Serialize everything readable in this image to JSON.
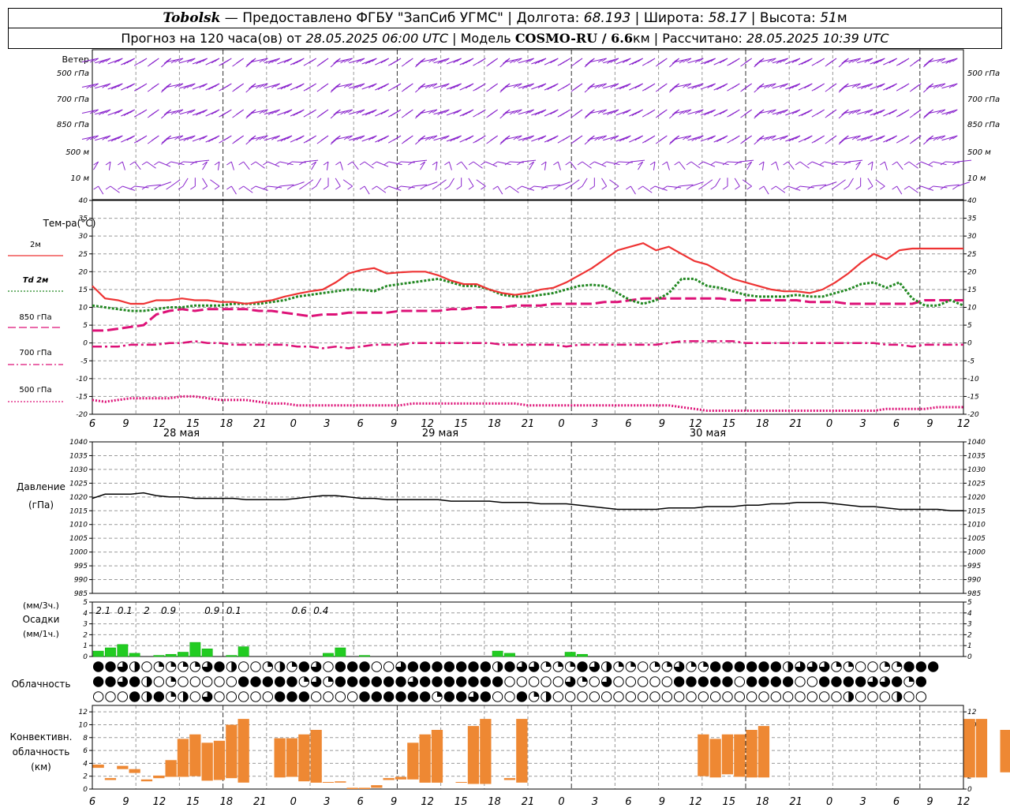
{
  "header": {
    "station": "Tobolsk",
    "provided": "— Предоставлено ФГБУ \"ЗапСиб УГМС\"",
    "lon_label": "Долгота:",
    "lon": "68.193",
    "lat_label": "Широта:",
    "lat": "58.17",
    "alt_label": "Высота:",
    "alt": "51",
    "alt_unit": "м",
    "forecast_label": "Прогноз на 120 часа(ов) от",
    "forecast_time": "28.05.2025 06:00 UTC",
    "model_label": "Модель",
    "model": "COSMO-RU / 6.6",
    "model_unit": "км",
    "calc_label": "Рассчитано:",
    "calc_time": "28.05.2025 10:39 UTC"
  },
  "labels": {
    "wind": "Ветер",
    "wind_levels": [
      "500 гПа",
      "700 гПа",
      "850 гПа",
      "500 м",
      "10 м"
    ],
    "temp_title": "Тем-ра(°С)",
    "legend": [
      {
        "label": "2м",
        "color": "#ee3333",
        "dash": "solid"
      },
      {
        "label": "Td 2м",
        "color": "#228822",
        "dash": "dotted"
      },
      {
        "label": "850 гПа",
        "color": "#dd1177",
        "dash": "longdash"
      },
      {
        "label": "700 гПа",
        "color": "#dd1177",
        "dash": "dashdot"
      },
      {
        "label": "500 гПа",
        "color": "#dd1177",
        "dash": "dot"
      }
    ],
    "pressure": "Давление",
    "pressure_unit": "(гПа)",
    "precip_unit1": "(мм/3ч.)",
    "precip": "Осадки",
    "precip_unit2": "(мм/1ч.)",
    "cloud": "Облачность",
    "conv1": "Конвективн.",
    "conv2": "облачность",
    "conv3": "(км)"
  },
  "chart_data": {
    "x_tick_labels": [
      "6",
      "9",
      "12",
      "15",
      "18",
      "21",
      "0",
      "3",
      "6",
      "9",
      "12",
      "15",
      "18",
      "21",
      "0",
      "3",
      "6",
      "9",
      "12",
      "15",
      "18",
      "21",
      "0",
      "3",
      "6",
      "9",
      "12"
    ],
    "date_labels": [
      "28 мая",
      "29 мая",
      "30 мая"
    ],
    "colors": {
      "wind": "#8822cc",
      "t2m": "#ee3333",
      "td": "#228822",
      "t850": "#dd1177",
      "precip": "#22cc22",
      "conv": "#ee8833"
    },
    "temperature": {
      "type": "line",
      "ylim": [
        -20,
        40
      ],
      "yticks": [
        -20,
        -15,
        -10,
        -5,
        0,
        5,
        10,
        15,
        20,
        25,
        30,
        35,
        40
      ],
      "t2m": [
        16,
        12.5,
        12,
        11,
        11,
        12,
        12,
        12.5,
        12,
        12,
        11.5,
        11.5,
        11,
        11.5,
        12,
        13,
        13.8,
        14.5,
        15,
        17,
        19.5,
        20.5,
        21,
        19.5,
        19.8,
        20,
        20,
        19,
        17.5,
        16.5,
        16.5,
        15,
        14,
        13.5,
        14,
        15,
        15.5,
        17,
        19,
        21,
        23.5,
        26,
        27,
        28,
        26,
        27,
        25,
        23,
        22,
        20,
        18,
        17,
        16,
        15,
        14.5,
        14.5,
        14,
        15,
        17,
        19.5,
        22.5,
        25,
        23.5,
        26,
        26.5,
        26.5,
        26.5,
        26.5,
        26.5
      ],
      "td2m": [
        10.5,
        10,
        9.5,
        9,
        9,
        9.5,
        10,
        10,
        10.5,
        10.5,
        10.5,
        11,
        11,
        11,
        11.5,
        12,
        13,
        13.5,
        14,
        14.5,
        15,
        15,
        14.5,
        16,
        16.5,
        17,
        17.5,
        18,
        17,
        16,
        16,
        15,
        13.5,
        13,
        13,
        13.5,
        14,
        15,
        16,
        16.3,
        16,
        14,
        12,
        11,
        12,
        14,
        18,
        18,
        16,
        15.5,
        14.5,
        13.5,
        13,
        13,
        13,
        13.5,
        13,
        13,
        14,
        15,
        16.5,
        17,
        15.5,
        17,
        12.5,
        10.5,
        10.5,
        12,
        10.5
      ],
      "t850": [
        3.5,
        3.5,
        4,
        4.5,
        5,
        8,
        9,
        9.5,
        9,
        9.5,
        9.5,
        9.5,
        9.5,
        9,
        9,
        8.5,
        8,
        7.5,
        8,
        8,
        8.5,
        8.5,
        8.5,
        8.5,
        9,
        9,
        9,
        9,
        9.5,
        9.5,
        10,
        10,
        10,
        10.5,
        10.5,
        10.5,
        11,
        11,
        11,
        11,
        11.5,
        11.5,
        12,
        12.5,
        12.5,
        12.5,
        12.5,
        12.5,
        12.5,
        12.5,
        12,
        12,
        12,
        12,
        12,
        12,
        11.5,
        11.5,
        11.5,
        11,
        11,
        11,
        11,
        11,
        11,
        12,
        12,
        12,
        12
      ],
      "t700": [
        -1,
        -1,
        -1,
        -0.5,
        -0.5,
        -0.5,
        0,
        0,
        0.5,
        0,
        0,
        -0.5,
        -0.5,
        -0.5,
        -0.5,
        -0.5,
        -1,
        -1,
        -1.5,
        -1,
        -1.5,
        -1,
        -0.5,
        -0.5,
        -0.5,
        0,
        0,
        0,
        0,
        0,
        0,
        0,
        -0.5,
        -0.5,
        -0.5,
        -0.5,
        -0.5,
        -1,
        -0.5,
        -0.5,
        -0.5,
        -0.5,
        -0.5,
        -0.5,
        -0.5,
        0,
        0.5,
        0.5,
        0.5,
        0.5,
        0.5,
        0,
        0,
        0,
        0,
        0,
        0,
        0,
        0,
        0,
        0,
        0,
        -0.5,
        -0.5,
        -1,
        -0.5,
        -0.5,
        -0.5,
        -0.5
      ],
      "t500": [
        -16,
        -16.5,
        -16,
        -15.5,
        -15.5,
        -15.5,
        -15.5,
        -15,
        -15,
        -15.5,
        -16,
        -16,
        -16,
        -16.5,
        -17,
        -17,
        -17.5,
        -17.5,
        -17.5,
        -17.5,
        -17.5,
        -17.5,
        -17.5,
        -17.5,
        -17.5,
        -17,
        -17,
        -17,
        -17,
        -17,
        -17,
        -17,
        -17,
        -17,
        -17.5,
        -17.5,
        -17.5,
        -17.5,
        -17.5,
        -17.5,
        -17.5,
        -17.5,
        -17.5,
        -17.5,
        -17.5,
        -17.5,
        -18,
        -18.5,
        -19,
        -19,
        -19,
        -19,
        -19,
        -19,
        -19,
        -19,
        -19,
        -19,
        -19,
        -19,
        -19,
        -19,
        -18.5,
        -18.5,
        -18.5,
        -18.5,
        -18,
        -18,
        -18
      ]
    },
    "pressure": {
      "type": "line",
      "ylim": [
        985,
        1040
      ],
      "yticks": [
        985,
        990,
        995,
        1000,
        1005,
        1010,
        1015,
        1020,
        1025,
        1030,
        1035,
        1040
      ],
      "values": [
        1019.5,
        1021,
        1021,
        1021,
        1021.5,
        1020.5,
        1020,
        1020,
        1019.5,
        1019.5,
        1019.5,
        1019.5,
        1019,
        1019,
        1019,
        1019,
        1019.5,
        1020,
        1020.5,
        1020.5,
        1020,
        1019.5,
        1019.5,
        1019,
        1019,
        1019,
        1019,
        1019,
        1018.5,
        1018.5,
        1018.5,
        1018.5,
        1018,
        1018,
        1018,
        1017.5,
        1017.5,
        1017.5,
        1017,
        1016.5,
        1016,
        1015.5,
        1015.5,
        1015.5,
        1015.5,
        1016,
        1016,
        1016,
        1016.5,
        1016.5,
        1016.5,
        1017,
        1017,
        1017.5,
        1017.5,
        1018,
        1018,
        1018,
        1017.5,
        1017,
        1016.5,
        1016.5,
        1016,
        1015.5,
        1015.5,
        1015.5,
        1015.5,
        1015,
        1015
      ]
    },
    "precipitation": {
      "type": "bar",
      "ylim": [
        0,
        5
      ],
      "yticks": [
        0,
        1,
        2,
        3,
        4,
        5
      ],
      "hourly": [
        0.5,
        0.8,
        1.1,
        0.3,
        0,
        0.1,
        0.2,
        0.4,
        1.3,
        0.7,
        0,
        0.1,
        0.9,
        0,
        0,
        0,
        0,
        0,
        0,
        0.3,
        0.8,
        0,
        0.1,
        0,
        0,
        0,
        0,
        0,
        0,
        0,
        0,
        0,
        0,
        0.5,
        0.3,
        0,
        0,
        0,
        0,
        0.4,
        0.2,
        0,
        0,
        0,
        0,
        0,
        0,
        0,
        0,
        0,
        0,
        0,
        0,
        0,
        0,
        0,
        0,
        0,
        0,
        0,
        0,
        0,
        0,
        0,
        0,
        0,
        0,
        0,
        0,
        0,
        0,
        0
      ],
      "totals_3h": [
        {
          "i": 0,
          "text": "2.1"
        },
        {
          "i": 1,
          "text": "0.1"
        },
        {
          "i": 2,
          "text": "2"
        },
        {
          "i": 3,
          "text": "0.9"
        },
        {
          "i": 5,
          "text": "0.9"
        },
        {
          "i": 6,
          "text": "0.1"
        },
        {
          "i": 9,
          "text": "0.6"
        },
        {
          "i": 10,
          "text": "0.4"
        }
      ]
    },
    "cloud_rows": [
      "4432011113420012143044400344444442433111432110113114444442333110011444",
      "443420100000444441314444443444444400000310300000444440444400444433414",
      "000424120300000444000044444414434004120000000000000000000000002000200"
    ],
    "convective": {
      "type": "range_bar",
      "ylim": [
        0,
        13
      ],
      "yticks": [
        0,
        2,
        4,
        6,
        8,
        10,
        12
      ],
      "bars": [
        [
          0,
          3.3,
          3.8
        ],
        [
          1,
          1.4,
          1.7
        ],
        [
          2,
          3.1,
          3.6
        ],
        [
          3,
          2.5,
          3.1
        ],
        [
          4,
          1.2,
          1.5
        ],
        [
          5,
          1.7,
          2.1
        ],
        [
          6,
          1.9,
          4.5
        ],
        [
          7,
          1.9,
          7.8
        ],
        [
          8,
          2.0,
          8.5
        ],
        [
          9,
          1.3,
          7.2
        ],
        [
          10,
          1.4,
          7.5
        ],
        [
          11,
          1.7,
          10
        ],
        [
          12,
          1.0,
          10.9
        ],
        [
          15,
          1.8,
          7.9
        ],
        [
          16,
          1.9,
          7.9
        ],
        [
          17,
          1.2,
          8.5
        ],
        [
          18,
          1.0,
          9.2
        ],
        [
          19,
          1.0,
          1.1
        ],
        [
          20,
          1.0,
          1.2
        ],
        [
          21,
          0,
          0.2
        ],
        [
          22,
          0,
          0.2
        ],
        [
          23,
          0.2,
          0.6
        ],
        [
          24,
          1.4,
          1.7
        ],
        [
          25,
          1.5,
          1.9
        ],
        [
          26,
          1.5,
          7.2
        ],
        [
          27,
          1.0,
          8.5
        ],
        [
          28,
          1.0,
          9.2
        ],
        [
          30,
          1.0,
          1.1
        ],
        [
          31,
          0.8,
          9.8
        ],
        [
          32,
          0.8,
          10.9
        ],
        [
          34,
          1.4,
          1.7
        ],
        [
          35,
          1.0,
          10.9
        ],
        [
          50,
          2.0,
          8.5
        ],
        [
          51,
          1.8,
          7.8
        ],
        [
          52,
          2.3,
          8.5
        ],
        [
          53,
          1.9,
          8.5
        ],
        [
          54,
          1.8,
          9.2
        ],
        [
          55,
          1.8,
          9.8
        ],
        [
          72,
          1.8,
          10.9
        ],
        [
          73,
          1.8,
          10.9
        ],
        [
          75,
          2.6,
          9.2
        ],
        [
          76,
          2.6,
          9.2
        ]
      ]
    }
  }
}
